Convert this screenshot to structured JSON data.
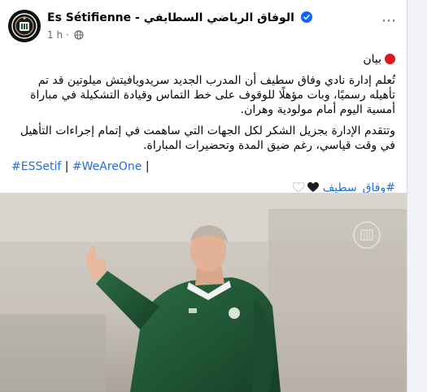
{
  "post": {
    "page_name": "Es Sétifienne",
    "page_name_sep": " - ",
    "page_name_ar": "الوفاق الرياضي السطايفي",
    "time": "1 h",
    "dot": "·",
    "more_icon": "more-horizontal-icon"
  },
  "content": {
    "heading": "بيان",
    "paragraph1": "تُعلم إدارة نادي وفاق سطيف أن المدرب الجديد سريدويافيتش ميلوتين قد تم تأهيله رسميًا، وبات مؤهلًا للوقوف على خط التماس وقيادة التشكيلة في مباراة أمسية اليوم أمام مولودية وهران.",
    "paragraph2": "وتتقدم الإدارة بجزيل الشكر لكل الجهات التي ساهمت في إتمام إجراءات التأهيل في وقت قياسي، رغم ضيق المدة وتحضيرات المباراة.",
    "hashtag1": "#ESSetif",
    "hashtag_sep1": " | ",
    "hashtag2": "#WeAreOne",
    "hashtag_sep2": " |",
    "hashtag_ar": "#وفاق_سطيف",
    "hearts": [
      "black-heart-icon",
      "white-heart-icon"
    ]
  },
  "colors": {
    "link": "#216fdb",
    "text": "#050505",
    "meta": "#65676b",
    "verified": "#0866ff",
    "jersey": "#1d5a35"
  }
}
